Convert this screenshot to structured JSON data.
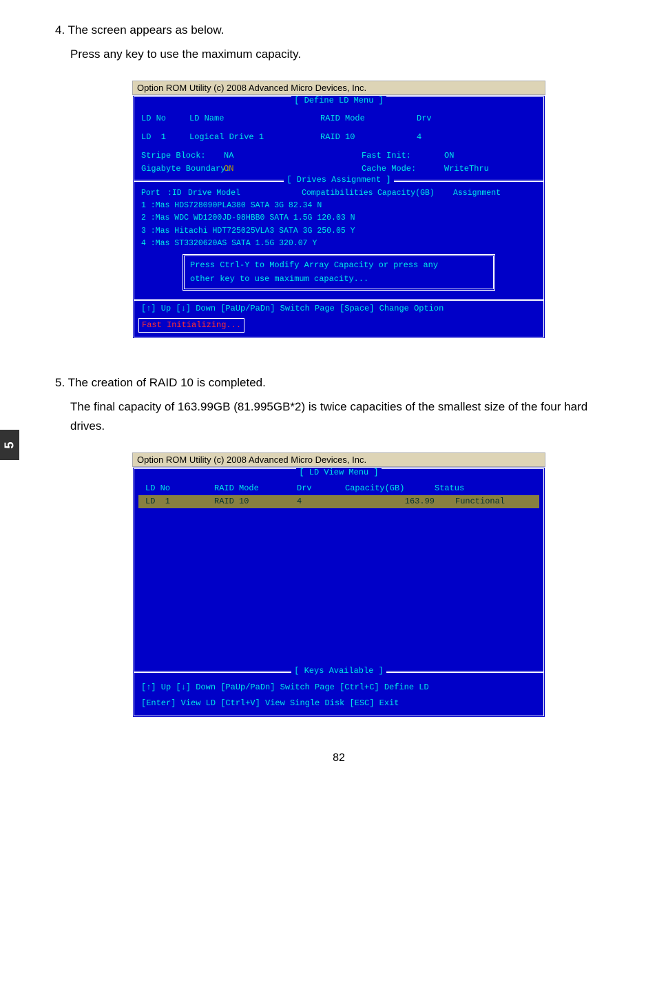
{
  "step4": {
    "num": "4.",
    "text": "The screen appears as below.",
    "sub": "Press any key to use the maximum capacity."
  },
  "step5": {
    "num": "5.",
    "text": "The creation of RAID 10 is completed.",
    "sub": "The final capacity of 163.99GB (81.995GB*2) is twice capacities of the smallest size of the four hard drives."
  },
  "bios1": {
    "title": "Option ROM Utility (c) 2008 Advanced Micro Devices, Inc.",
    "menu_title": "[ Define LD Menu ]",
    "header": {
      "ldno": "LD No",
      "ldname": "LD Name",
      "raidmode": "RAID Mode",
      "drv": "Drv"
    },
    "ld1": {
      "ldno": "LD  1",
      "ldname": "Logical Drive 1",
      "raidmode": "RAID 10",
      "drv": "4"
    },
    "settings": {
      "stripe_label": "Stripe Block:",
      "stripe_val": "NA",
      "gig_label": "Gigabyte Boundary:",
      "gig_val": "ON",
      "fast_label": "Fast Init:",
      "fast_val": "ON",
      "cache_label": "Cache Mode:",
      "cache_val": "WriteThru"
    },
    "drives_title": "[ Drives Assignment ]",
    "drives_header": {
      "port": "Port",
      "id": ":ID",
      "model": "Drive Model",
      "compat": "Compatibilities",
      "cap": "Capacity(GB)",
      "assign": "Assignment"
    },
    "drives": [
      {
        "row": "       1 :Mas HDS728090PLA380          SATA  3G              82.34             N"
      },
      {
        "row": "       2 :Mas WDC WD1200JD-98HBB0 SATA  1.5G           120.03             N"
      },
      {
        "row": "       3 :Mas Hitachi HDT725025VLA3    SATA  3G             250.05             Y"
      },
      {
        "row": "       4 :Mas ST3320620AS                SATA  1.5G           320.07             Y"
      }
    ],
    "modal": {
      "line1": "Press Ctrl-Y to Modify Array Capacity or press any",
      "line2": "other key to use maximum capacity..."
    },
    "keys": "[↑] Up    [↓] Down    [PaUp/PaDn] Switch Page    [Space] Change Option",
    "status": "Fast  Initializing..."
  },
  "bios2": {
    "title": "Option ROM Utility (c) 2008 Advanced Micro Devices, Inc.",
    "menu_title": "[ LD View Menu ]",
    "header": {
      "ldno": "LD No",
      "raidmode": "RAID Mode",
      "drv": "Drv",
      "cap": "Capacity(GB)",
      "status": "Status"
    },
    "row1": {
      "ldno": "LD  1",
      "raidmode": "RAID 10",
      "drv": "4",
      "cap": "163.99",
      "status": "Functional"
    },
    "keys_title": "[ Keys Available ]",
    "keys_line1": "[↑] Up    [↓] Down    [PaUp/PaDn] Switch Page    [Ctrl+C] Define LD",
    "keys_line2": "[Enter] View LD    [Ctrl+V] View Single Disk    [ESC] Exit"
  },
  "sidebar": "5",
  "page_num": "82"
}
